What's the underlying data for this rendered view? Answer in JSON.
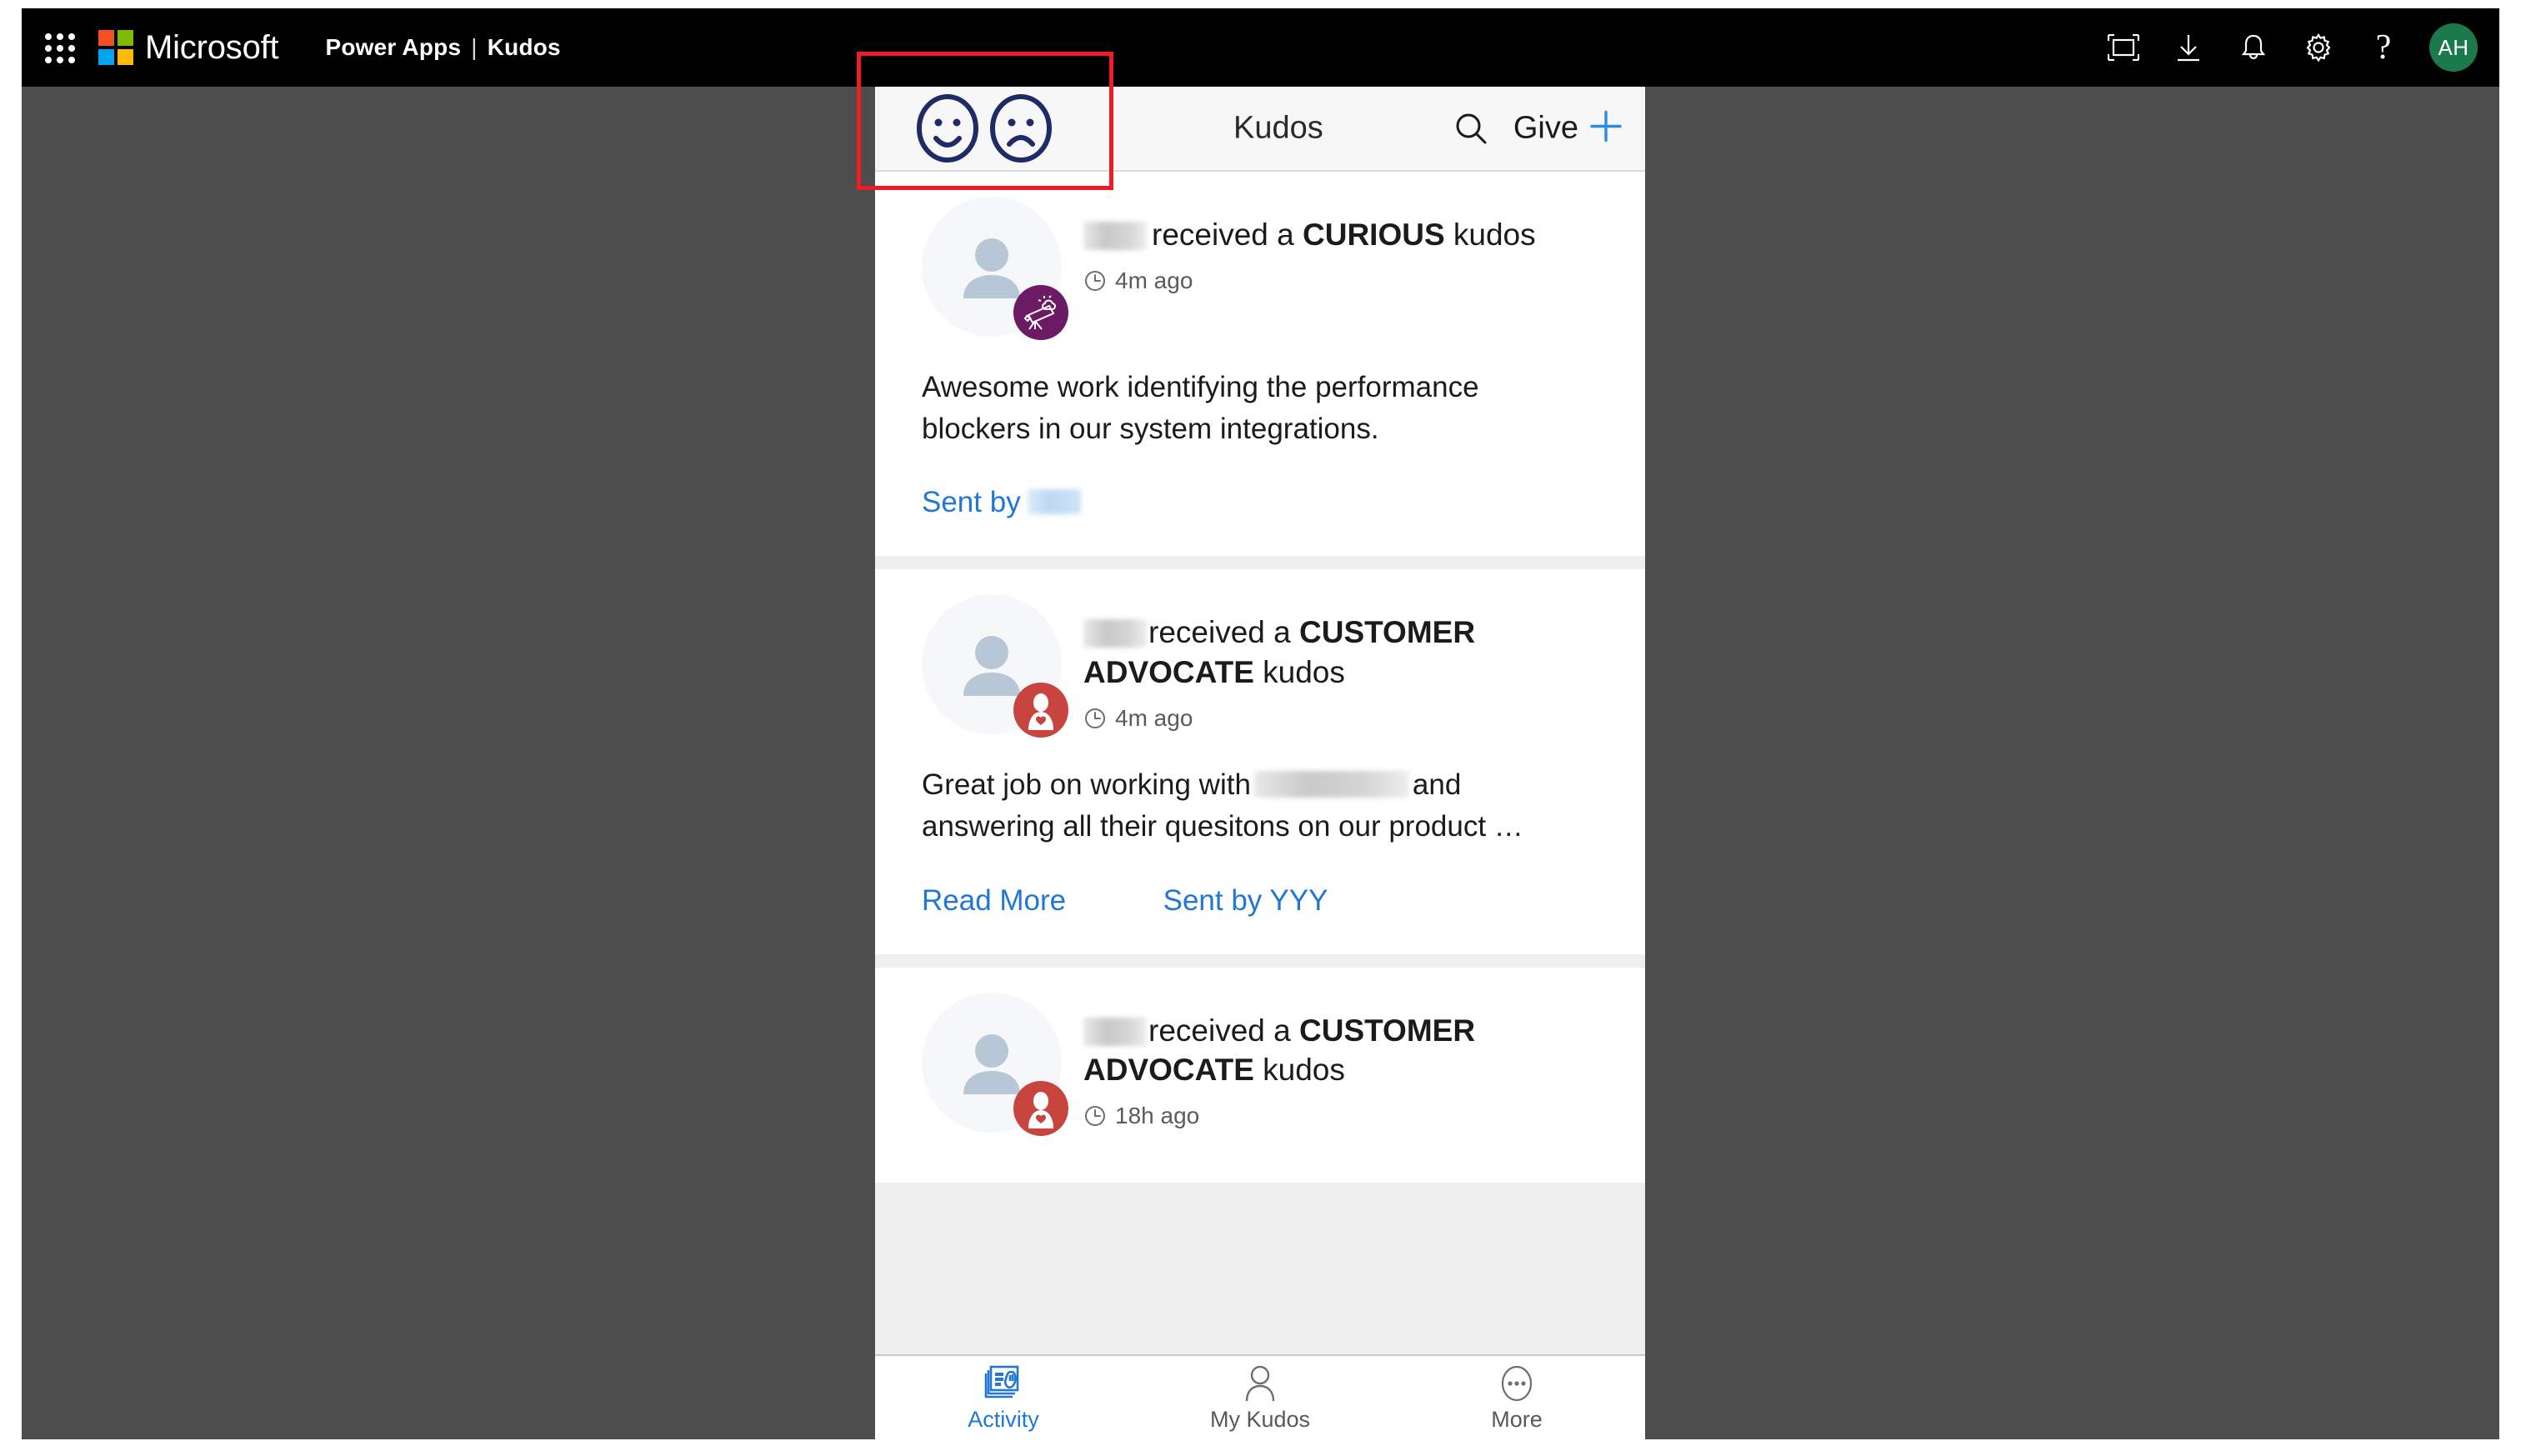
{
  "suite": {
    "brand": "Microsoft",
    "app_name": "Power Apps",
    "separator": "|",
    "page_name": "Kudos",
    "waffle_icon": "app-launcher-icon",
    "icons": [
      {
        "name": "focus-mode-icon",
        "label": "Focus mode"
      },
      {
        "name": "download-icon",
        "label": "Download"
      },
      {
        "name": "notification-bell-icon",
        "label": "Notifications"
      },
      {
        "name": "settings-gear-icon",
        "label": "Settings"
      },
      {
        "name": "help-question-icon",
        "label": "?"
      }
    ],
    "avatar_initials": "AH",
    "avatar_color": "#1b7a4b",
    "bar_color": "#000000"
  },
  "app": {
    "header": {
      "happy_face_icon": "happy-face-icon",
      "sad_face_icon": "sad-face-icon",
      "face_color": "#1f2a66",
      "title": "Kudos",
      "search_icon": "search-icon",
      "give_label": "Give",
      "plus_icon": "plus-icon",
      "plus_color": "#2b8ce0"
    },
    "feed": {
      "cards": [
        {
          "recipient_redacted": true,
          "received_text": "received a",
          "kudos_type": "CURIOUS",
          "kudos_suffix": "kudos",
          "time": "4m ago",
          "clock_icon": "clock-icon",
          "badge_icon": "telescope-icon",
          "badge_color": "#6b1a63",
          "body": "Awesome work identifying the performance blockers in our system integrations.",
          "read_more": null,
          "sent_by_label": "Sent by",
          "sent_by_name": null,
          "sent_by_redacted": true
        },
        {
          "recipient_redacted": true,
          "received_text": "received a",
          "kudos_type": "CUSTOMER ADVOCATE",
          "kudos_suffix": "kudos",
          "time": "4m ago",
          "clock_icon": "clock-icon",
          "badge_icon": "customer-advocate-icon",
          "badge_color": "#c8453f",
          "body_before": "Great job on working with",
          "body_after": "and answering all their quesitons on our product …",
          "body_redacted": true,
          "read_more": "Read More",
          "sent_by_label": "Sent by YYY",
          "sent_by_redacted": false
        },
        {
          "recipient_redacted": true,
          "received_text": "received a",
          "kudos_type": "CUSTOMER ADVOCATE",
          "kudos_suffix": "kudos",
          "time": "18h ago",
          "clock_icon": "clock-icon",
          "badge_icon": "customer-advocate-icon",
          "badge_color": "#c8453f"
        }
      ]
    },
    "bottom_nav": {
      "items": [
        {
          "label": "Activity",
          "icon": "activity-feed-icon",
          "active": true
        },
        {
          "label": "My Kudos",
          "icon": "person-icon",
          "active": false
        },
        {
          "label": "More",
          "icon": "more-ellipsis-icon",
          "active": false
        }
      ],
      "active_color": "#2078d4",
      "inactive_color": "#595959"
    }
  },
  "annotation": {
    "highlight_color": "#ee1c25",
    "target": "faces-toggle-region"
  }
}
